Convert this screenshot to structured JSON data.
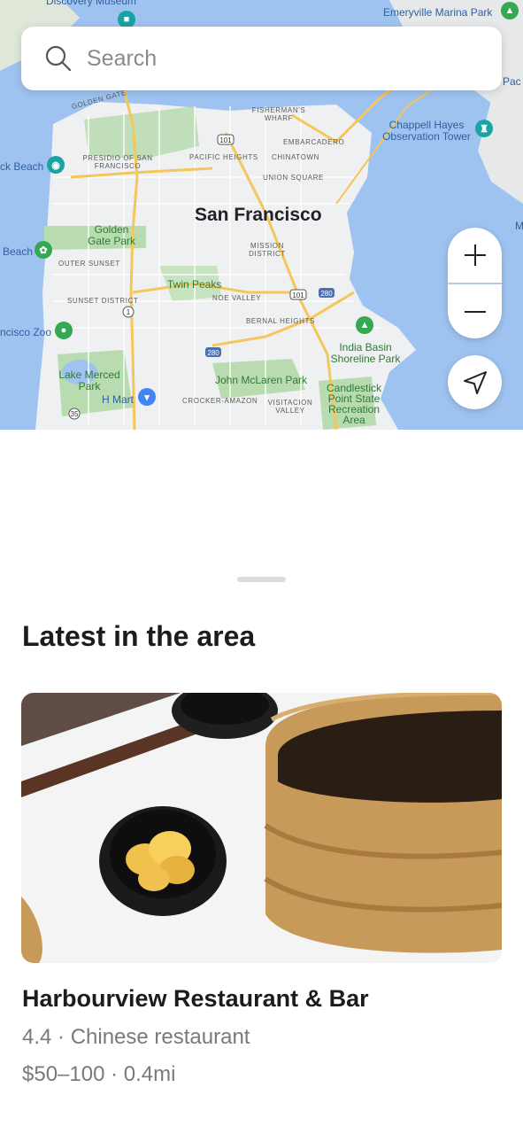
{
  "search": {
    "placeholder": "Search",
    "icon": "search-icon"
  },
  "map": {
    "city_label": "San Francisco",
    "labels": {
      "discovery_museum": "Discovery Museum",
      "emeryville_marina": "Emeryville Marina Park",
      "golden_gate": "Golden Gate",
      "fishermans_wharf": "FISHERMAN'S WHARF",
      "embarcadero": "EMBARCADERO",
      "chappell_hayes": "Chappell Hayes Observation Tower",
      "pacific_heights": "PACIFIC HEIGHTS",
      "chinatown": "CHINATOWN",
      "presidio": "PRESIDIO OF SAN FRANCISCO",
      "union_square": "UNION SQUARE",
      "beach_left": "ck Beach",
      "golden_gate_park": "Golden Gate Park",
      "mission_district": "MISSION DISTRICT",
      "beach_left2": "Beach",
      "outer_sunset": "OUTER SUNSET",
      "twin_peaks": "Twin Peaks",
      "sunset_district": "SUNSET DISTRICT",
      "noe_valley": "NOE VALLEY",
      "zoo": "ncisco Zoo",
      "bernal_heights": "BERNAL HEIGHTS",
      "india_basin": "India Basin Shoreline Park",
      "lake_merced": "Lake Merced Park",
      "h_mart": "H Mart",
      "john_mclaren": "John McLaren Park",
      "crocker_amazon": "CROCKER-AMAZON",
      "visitacion_valley": "VISITACION VALLEY",
      "candlestick": "Candlestick Point State Recreation Area",
      "pac": "Pac",
      "memo": "Memo",
      "highway_101": "101",
      "highway_280": "280",
      "highway_1": "1",
      "highway_35": "35"
    }
  },
  "controls": {
    "zoom_in_icon": "plus-icon",
    "zoom_out_icon": "minus-icon",
    "locate_icon": "navigation-arrow-icon"
  },
  "sheet": {
    "title": "Latest in the area",
    "card": {
      "name": "Harbourview Restaurant & Bar",
      "rating_category": "4.4 · Chinese restaurant",
      "price_distance": "$50–100 · 0.4mi"
    }
  },
  "colors": {
    "water": "#9fc3f0",
    "land": "#eef0f2",
    "park": "#b8dbb0",
    "highway": "#f5c659",
    "text_primary": "#1c1c1e",
    "text_secondary": "#7a7a7a"
  }
}
